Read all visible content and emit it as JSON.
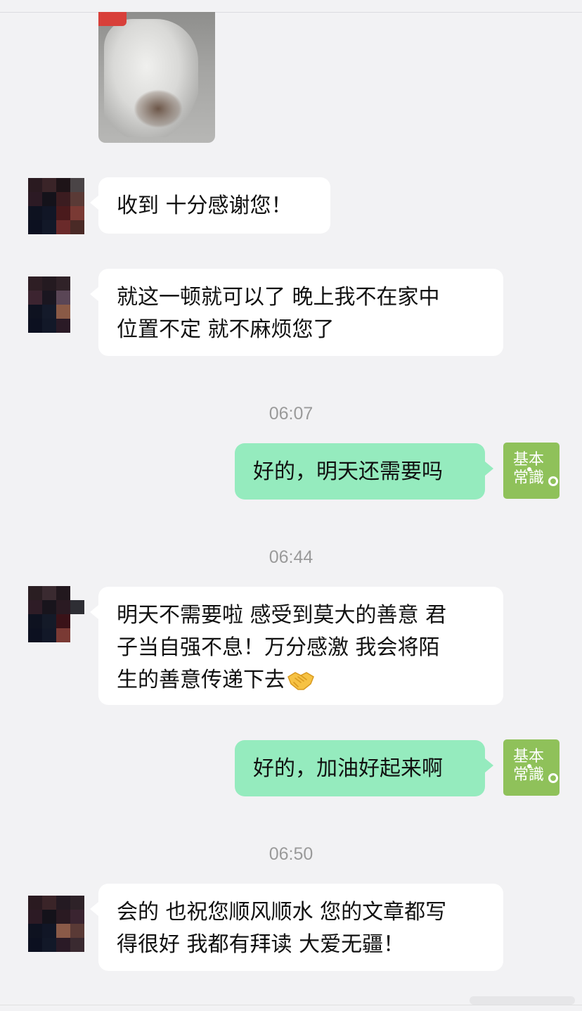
{
  "messages": [
    {
      "text": "收到 十分感谢您！"
    },
    {
      "text_line1": "就这一顿就可以了 晚上我不在家中",
      "text_line2": "位置不定 就不麻烦您了"
    },
    {
      "text": "好的，明天还需要吗"
    },
    {
      "text_line1": "明天不需要啦 感受到莫大的善意 君",
      "text_line2": "子当自强不息！万分感激 我会将陌",
      "text_line3": "生的善意传递下去"
    },
    {
      "text": "好的，加油好起来啊"
    },
    {
      "text_line1": "会的 也祝您顺风顺水 您的文章都写",
      "text_line2": "得很好 我都有拜读 大爱无疆！"
    }
  ],
  "timestamps": [
    "06:07",
    "06:44",
    "06:50"
  ],
  "my_avatar": {
    "line1": "基本",
    "line2": "常識"
  },
  "icons": {
    "photo": "photo-thumbnail",
    "handshake": "handshake-emoji"
  },
  "colors": {
    "background": "#f2f2f4",
    "incoming_bubble": "#ffffff",
    "outgoing_bubble": "#95ebbe",
    "my_avatar_bg": "#8fc15a",
    "timestamp": "#9a9a9a"
  }
}
